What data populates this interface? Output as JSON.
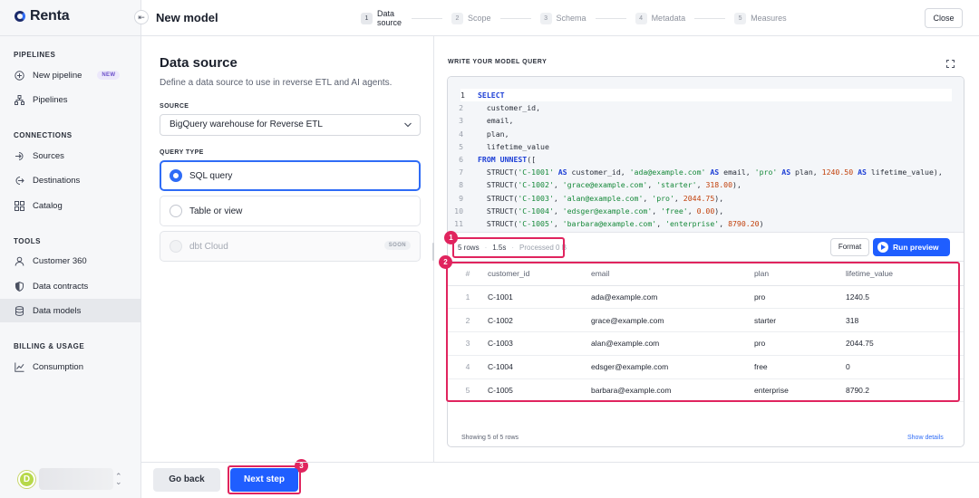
{
  "brand": {
    "name": "Renta"
  },
  "sidebar": {
    "sections": [
      {
        "heading": "PIPELINES",
        "items": [
          {
            "label": "New pipeline",
            "icon": "plus-circle-icon",
            "badge": "NEW"
          },
          {
            "label": "Pipelines",
            "icon": "hierarchy-icon"
          }
        ]
      },
      {
        "heading": "CONNECTIONS",
        "items": [
          {
            "label": "Sources",
            "icon": "sign-in-icon"
          },
          {
            "label": "Destinations",
            "icon": "sign-out-icon"
          },
          {
            "label": "Catalog",
            "icon": "grid-icon"
          }
        ]
      },
      {
        "heading": "TOOLS",
        "items": [
          {
            "label": "Customer 360",
            "icon": "user-icon"
          },
          {
            "label": "Data contracts",
            "icon": "shield-icon"
          },
          {
            "label": "Data models",
            "icon": "database-icon",
            "active": true
          }
        ]
      },
      {
        "heading": "BILLING & USAGE",
        "items": [
          {
            "label": "Consumption",
            "icon": "chart-line-icon"
          }
        ]
      }
    ],
    "user": {
      "avatar_initial": "D"
    }
  },
  "header": {
    "title": "New model",
    "close_label": "Close",
    "steps": [
      {
        "num": "1",
        "label": "Data source",
        "current": true
      },
      {
        "num": "2",
        "label": "Scope"
      },
      {
        "num": "3",
        "label": "Schema"
      },
      {
        "num": "4",
        "label": "Metadata"
      },
      {
        "num": "5",
        "label": "Measures"
      }
    ]
  },
  "form": {
    "title": "Data source",
    "subtitle": "Define a data source to use in reverse ETL and AI agents.",
    "source_label": "SOURCE",
    "source_value": "BigQuery warehouse for Reverse ETL",
    "query_type_label": "QUERY TYPE",
    "options": [
      {
        "label": "SQL query",
        "selected": true
      },
      {
        "label": "Table or view"
      },
      {
        "label": "dbt Cloud",
        "disabled": true,
        "badge": "SOON"
      }
    ]
  },
  "query": {
    "label": "WRITE YOUR MODEL QUERY",
    "code_lines": [
      "SELECT",
      "  customer_id,",
      "  email,",
      "  plan,",
      "  lifetime_value",
      "FROM UNNEST([",
      "  STRUCT('C-1001' AS customer_id, 'ada@example.com' AS email, 'pro' AS plan, 1240.50 AS lifetime_value),",
      "  STRUCT('C-1002', 'grace@example.com', 'starter', 318.00),",
      "  STRUCT('C-1003', 'alan@example.com', 'pro', 2044.75),",
      "  STRUCT('C-1004', 'edsger@example.com', 'free', 0.00),",
      "  STRUCT('C-1005', 'barbara@example.com', 'enterprise', 8790.20)"
    ],
    "meta": {
      "rows": "5 rows",
      "time": "1.5s",
      "processed": "Processed 0 B"
    },
    "format_label": "Format",
    "run_label": "Run preview",
    "table": {
      "columns": [
        "#",
        "customer_id",
        "email",
        "plan",
        "lifetime_value"
      ],
      "rows": [
        [
          "1",
          "C-1001",
          "ada@example.com",
          "pro",
          "1240.5"
        ],
        [
          "2",
          "C-1002",
          "grace@example.com",
          "starter",
          "318"
        ],
        [
          "3",
          "C-1003",
          "alan@example.com",
          "pro",
          "2044.75"
        ],
        [
          "4",
          "C-1004",
          "edsger@example.com",
          "free",
          "0"
        ],
        [
          "5",
          "C-1005",
          "barbara@example.com",
          "enterprise",
          "8790.2"
        ]
      ]
    },
    "footer_left": "Showing 5 of 5 rows",
    "footer_right": "Show details"
  },
  "markers": [
    "1",
    "2",
    "3"
  ],
  "footer": {
    "back_label": "Go back",
    "next_label": "Next step"
  },
  "colors": {
    "accent": "#1f5eff",
    "highlight": "#e0245e"
  }
}
